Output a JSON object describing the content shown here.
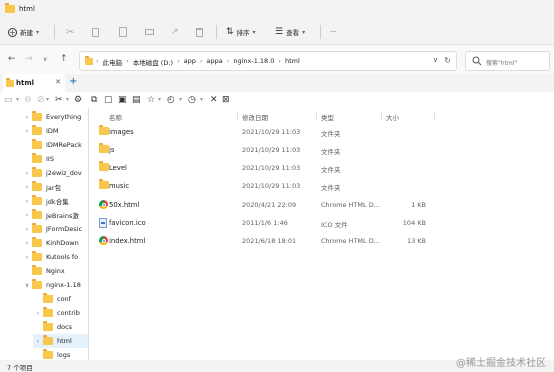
{
  "window": {
    "title": "html"
  },
  "commandbar": {
    "new_label": "新建",
    "sort_label": "排序",
    "view_label": "查看",
    "more": "···"
  },
  "address": {
    "crumbs": [
      "此电脑",
      "本地磁盘 (D:)",
      "app",
      "appa",
      "nginx-1.18.0",
      "html"
    ],
    "search_placeholder": "搜索\"html\""
  },
  "tab": {
    "label": "html"
  },
  "columns": {
    "name": "名称",
    "date": "修改日期",
    "type": "类型",
    "size": "大小"
  },
  "files": [
    {
      "name": "images",
      "date": "2021/10/29 11:03",
      "type": "文件夹",
      "size": "",
      "icon": "folder-icon"
    },
    {
      "name": "js",
      "date": "2021/10/29 11:03",
      "type": "文件夹",
      "size": "",
      "icon": "folder-icon"
    },
    {
      "name": "Level",
      "date": "2021/10/29 11:03",
      "type": "文件夹",
      "size": "",
      "icon": "folder-icon"
    },
    {
      "name": "music",
      "date": "2021/10/29 11:03",
      "type": "文件夹",
      "size": "",
      "icon": "folder-icon"
    },
    {
      "name": "50x.html",
      "date": "2020/4/21 22:09",
      "type": "Chrome HTML D...",
      "size": "1 KB",
      "icon": "chrome-icon"
    },
    {
      "name": "favicon.ico",
      "date": "2011/1/6 1:46",
      "type": "ICO 文件",
      "size": "104 KB",
      "icon": "ico-file-icon"
    },
    {
      "name": "index.html",
      "date": "2021/6/18 18:01",
      "type": "Chrome HTML D...",
      "size": "13 KB",
      "icon": "chrome-icon"
    }
  ],
  "sidebar": [
    "Everything",
    "IDM",
    "IDMRePack",
    "IIS",
    "j2ewiz_dov",
    "Jar包",
    "jdk合集",
    "JeBrains激",
    "JFormDesic",
    "KinhDown",
    "Kutools fo",
    "Nginx",
    "nginx-1.18",
    "conf",
    "contrib",
    "docs",
    "html",
    "logs"
  ],
  "status": {
    "count": "7 个项目"
  },
  "watermark": "@稀土掘金技术社区"
}
